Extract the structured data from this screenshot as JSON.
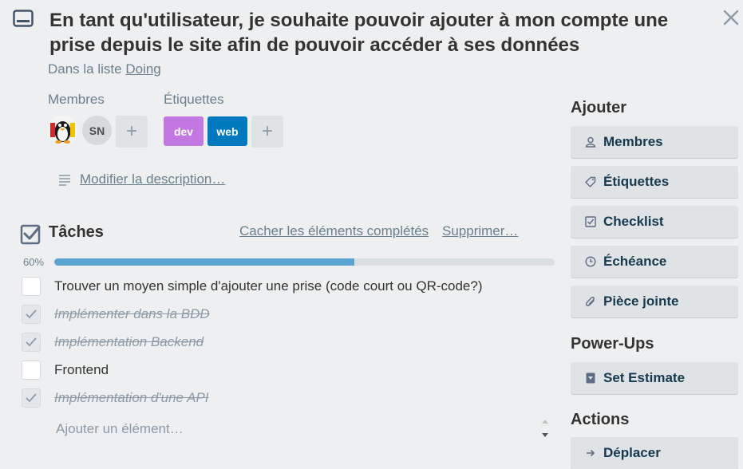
{
  "card": {
    "title": "En tant qu'utilisateur, je souhaite pouvoir ajouter à mon compte une prise depuis le site afin de pouvoir accéder à ses données",
    "list_prefix": "Dans la liste",
    "list_name": "Doing"
  },
  "members": {
    "label": "Membres",
    "avatars": [
      {
        "initials": ""
      },
      {
        "initials": "SN"
      }
    ],
    "add_symbol": "+"
  },
  "labels": {
    "label": "Étiquettes",
    "tags": [
      {
        "text": "dev",
        "color": "#c377e0"
      },
      {
        "text": "web",
        "color": "#0079bf"
      }
    ],
    "add_symbol": "+"
  },
  "description": {
    "edit_link": "Modifier la description…"
  },
  "checklist": {
    "title": "Tâches",
    "hide_completed": "Cacher les éléments complétés",
    "delete": "Supprimer…",
    "progress_label": "60%",
    "progress": 0.6,
    "items": [
      {
        "text": "Trouver un moyen simple d'ajouter une prise (code court ou QR-code?)",
        "done": false
      },
      {
        "text": "Implémenter dans la BDD",
        "done": true
      },
      {
        "text": "Implémentation Backend",
        "done": true
      },
      {
        "text": "Frontend",
        "done": false
      },
      {
        "text": "Implémentation d'une API",
        "done": true
      }
    ],
    "add_placeholder": "Ajouter un élément…"
  },
  "sidebar": {
    "add_heading": "Ajouter",
    "add_buttons": [
      {
        "label": "Membres",
        "icon": "person-icon"
      },
      {
        "label": "Étiquettes",
        "icon": "tag-icon"
      },
      {
        "label": "Checklist",
        "icon": "checklist-icon"
      },
      {
        "label": "Échéance",
        "icon": "clock-icon"
      },
      {
        "label": "Pièce jointe",
        "icon": "paperclip-icon"
      }
    ],
    "powerups_heading": "Power-Ups",
    "powerups_buttons": [
      {
        "label": "Set Estimate",
        "icon": "estimate-icon"
      }
    ],
    "actions_heading": "Actions",
    "actions_buttons": [
      {
        "label": "Déplacer",
        "icon": "arrow-right-icon"
      }
    ]
  },
  "colors": {
    "background": "#edeff0",
    "progress_fill": "#5ba4cf",
    "progress_track": "#dadfe2",
    "button_bg": "#dfe3e6"
  }
}
